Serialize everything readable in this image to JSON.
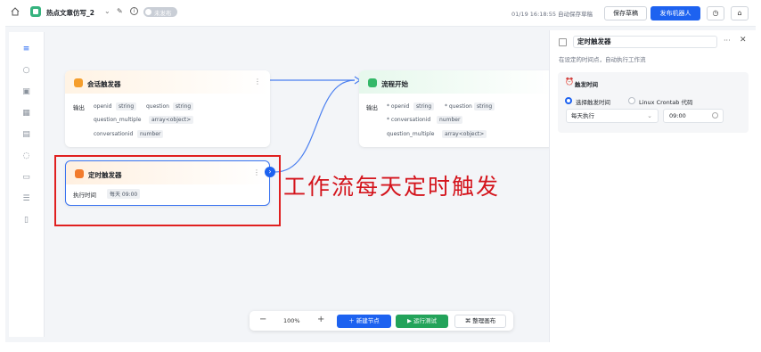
{
  "header": {
    "app_title": "热点文章仿写_2",
    "publish_state": "未发布",
    "save_status": "01/19 16:18:55 自动保存草稿",
    "save_draft": "保存草稿",
    "publish_bot": "发布机器人"
  },
  "nodes": {
    "chat_trigger": {
      "title": "会话触发器",
      "output_label": "输出",
      "fields": [
        {
          "name": "openid",
          "type": "string"
        },
        {
          "name": "question",
          "type": "string"
        },
        {
          "name": "question_multiple",
          "type": "array<object>"
        },
        {
          "name": "conversationid",
          "type": "number"
        }
      ]
    },
    "flow_start": {
      "title": "流程开始",
      "output_label": "输出",
      "fields": [
        {
          "name": "* openid",
          "type": "string"
        },
        {
          "name": "* question",
          "type": "string"
        },
        {
          "name": "* conversationid",
          "type": "number"
        },
        {
          "name": "question_multiple",
          "type": "array<object>"
        }
      ]
    },
    "timer_trigger": {
      "title": "定时触发器",
      "exec_label": "执行时间",
      "exec_value": "每天 09:00"
    }
  },
  "annotation": "工作流每天定时触发",
  "toolbar": {
    "zoom": "100%",
    "add_node": "新建节点",
    "run_test": "运行测试",
    "tidy_canvas": "整理画布"
  },
  "panel": {
    "title": "定时触发器",
    "description": "在设定的时间点，自动执行工作流",
    "section_title": "触发时间",
    "option_select_time": "选择触发时间",
    "option_crontab": "Linux Crontab 代码",
    "frequency": "每天执行",
    "time": "09:00"
  },
  "colors": {
    "accent": "#1d62f0",
    "run_green": "#23a35a",
    "annotation_red": "#d4141c"
  }
}
